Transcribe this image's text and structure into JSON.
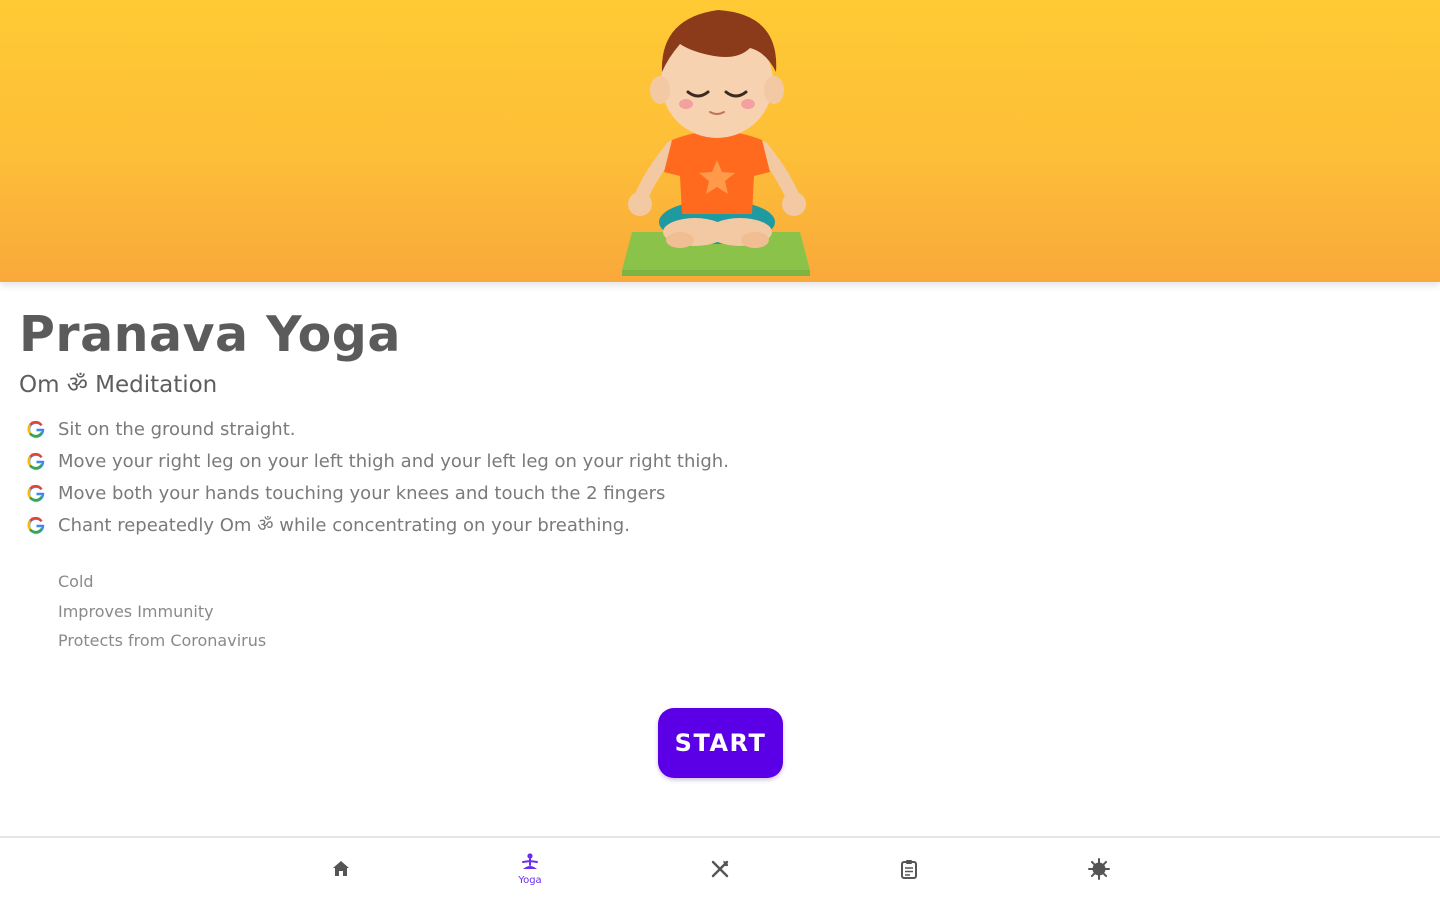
{
  "header": {
    "illustration": "child-meditating-illustration"
  },
  "content": {
    "title": "Pranava Yoga",
    "subtitle": "Om ॐ Meditation",
    "steps": [
      {
        "icon": "google-g-icon",
        "text": "Sit on the ground straight."
      },
      {
        "icon": "google-g-icon",
        "text": "Move your right leg on your left thigh and your left leg on your right thigh."
      },
      {
        "icon": "google-g-icon",
        "text": "Move both your hands touching your knees and touch the 2 fingers"
      },
      {
        "icon": "google-g-icon",
        "text": "Chant repeatedly Om ॐ while concentrating on your breathing."
      }
    ],
    "benefits": [
      "Cold",
      "Improves Immunity",
      "Protects from Coronavirus"
    ],
    "start_label": "START"
  },
  "nav": {
    "items": [
      {
        "icon": "home-icon",
        "label": ""
      },
      {
        "icon": "yoga-icon",
        "label": "Yoga",
        "active": true
      },
      {
        "icon": "fork-knife-icon",
        "label": ""
      },
      {
        "icon": "clipboard-icon",
        "label": ""
      },
      {
        "icon": "virus-icon",
        "label": ""
      }
    ]
  },
  "colors": {
    "hero_top": "#FFCA33",
    "hero_bottom": "#F9A93B",
    "accent": "#5B00E6",
    "title_text": "#5b5b5b",
    "body_text": "#7a7a7a"
  }
}
